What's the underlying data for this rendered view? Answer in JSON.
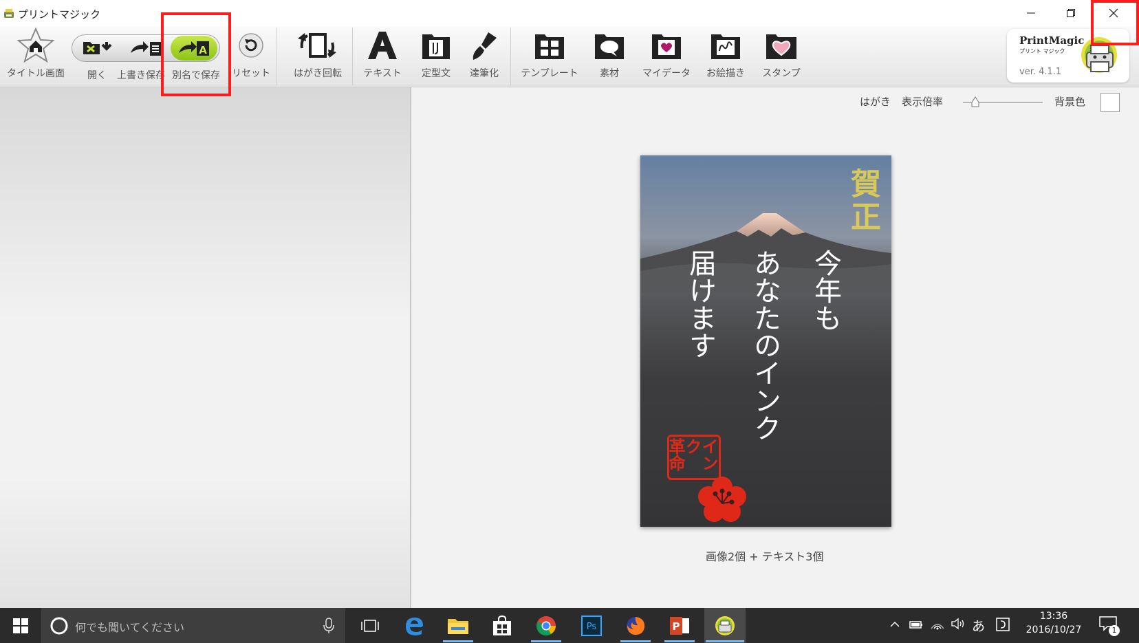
{
  "window": {
    "title": "プリントマジック"
  },
  "toolbar": {
    "title_screen": "タイトル画面",
    "open": "開く",
    "overwrite_save": "上書き保存",
    "save_as": "別名で保存",
    "reset": "リセット",
    "rotate": "はがき回転",
    "text": "テキスト",
    "template_phrase": "定型文",
    "brush_style": "達筆化",
    "template": "テンプレート",
    "material": "素材",
    "my_data": "マイデータ",
    "drawing": "お絵描き",
    "stamp": "スタンプ"
  },
  "brand": {
    "logo": "PrintMagic",
    "logo_sub": "プリント マジック",
    "version": "ver. 4.1.1"
  },
  "view": {
    "card_type": "はがき",
    "zoom_label": "表示倍率",
    "bg_color_label": "背景色"
  },
  "card": {
    "greeting": "賀正",
    "line1": "今年も",
    "line2": "あなたのインク",
    "line3": "届けます",
    "seal": [
      "イン",
      "ク",
      "革命"
    ]
  },
  "status": {
    "summary": "画像2個 + テキスト3個"
  },
  "taskbar": {
    "search_placeholder": "何でも聞いてください",
    "ime": "あ",
    "time": "13:36",
    "date": "2016/10/27",
    "notifications": "1"
  },
  "colors": {
    "highlight": "#ff1c1c",
    "greeting_gold": "#d8c95a",
    "seal_red": "#e02818"
  }
}
